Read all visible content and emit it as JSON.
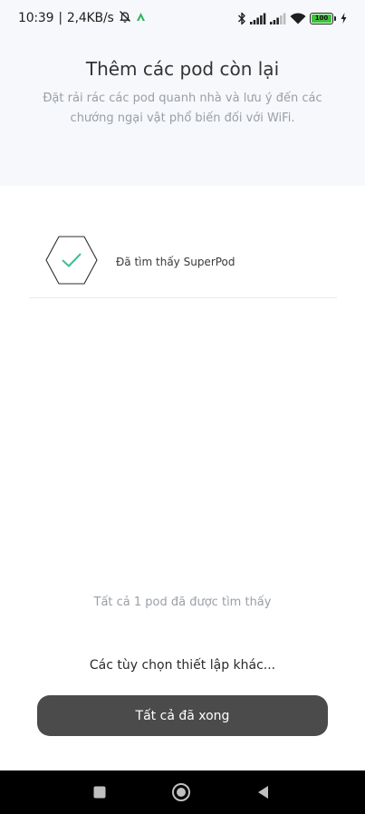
{
  "status_bar": {
    "time": "10:39",
    "separator": "|",
    "network_speed": "2,4KB/s",
    "battery_level": "100",
    "icons": [
      "mute-bell-icon",
      "app-notification-icon",
      "bluetooth-icon",
      "signal-icon",
      "signal-icon-2",
      "wifi-icon",
      "battery-icon",
      "charging-icon"
    ]
  },
  "header": {
    "title": "Thêm các pod còn lại",
    "subtitle": "Đặt rải rác các pod quanh nhà và lưu ý đến các chướng ngại vật phổ biến đối với WiFi."
  },
  "pods": [
    {
      "label": "Đã tìm thấy SuperPod",
      "icon": "hexagon-check-icon",
      "status_color": "#3fbf8f"
    }
  ],
  "footer": {
    "found_count": "Tất cả 1 pod đã được tìm thấy",
    "more_options": "Các tùy chọn thiết lập khác...",
    "done_button": "Tất cả đã xong"
  },
  "nav_bar": {
    "buttons": [
      "recent-apps-icon",
      "home-icon",
      "back-icon"
    ]
  },
  "colors": {
    "header_bg": "#f6f8fb",
    "button_bg": "#4b4b4b",
    "check": "#3fbf8f",
    "battery": "#3fc23b"
  }
}
